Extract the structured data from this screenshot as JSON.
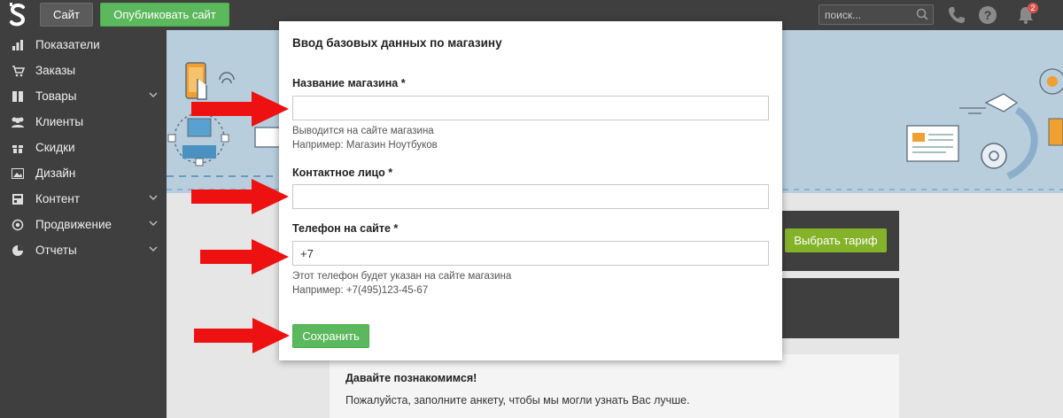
{
  "topbar": {
    "logo_text": "S",
    "site_label": "Сайт",
    "publish_label": "Опубликовать сайт",
    "search_placeholder": "поиск...",
    "notifications_count": "2"
  },
  "sidebar": {
    "items": [
      {
        "label": "Показатели",
        "icon": "bar-chart-icon"
      },
      {
        "label": "Заказы",
        "icon": "cart-icon"
      },
      {
        "label": "Товары",
        "icon": "book-icon",
        "expandable": true
      },
      {
        "label": "Клиенты",
        "icon": "users-icon"
      },
      {
        "label": "Скидки",
        "icon": "gift-icon"
      },
      {
        "label": "Дизайн",
        "icon": "image-icon"
      },
      {
        "label": "Контент",
        "icon": "layout-icon",
        "expandable": true
      },
      {
        "label": "Продвижение",
        "icon": "target-icon",
        "expandable": true
      },
      {
        "label": "Отчеты",
        "icon": "pie-chart-icon",
        "expandable": true
      }
    ]
  },
  "main": {
    "tariff_label": "Выбрать тариф",
    "card": {
      "title": "Давайте познакомимся!",
      "text": "Пожалуйста, заполните анкету, чтобы мы могли узнать Вас лучше."
    }
  },
  "modal": {
    "title": "Ввод базовых данных по магазину",
    "store_name": {
      "label": "Название магазина *",
      "value": "",
      "hint1": "Выводится на сайте магазина",
      "hint2": "Например: Магазин Ноутбуков"
    },
    "contact": {
      "label": "Контактное лицо *",
      "value": ""
    },
    "phone": {
      "label": "Телефон на сайте *",
      "value": "+7",
      "hint1": "Этот телефон будет указан на сайте магазина",
      "hint2": "Например: +7(495)123-45-67"
    },
    "save_label": "Сохранить"
  },
  "colors": {
    "topbar": "#3f3f3f",
    "green": "#5cb85c",
    "tariff_green": "#84b32a",
    "hero_blue": "#b9cedd",
    "arrow_red": "#ee1111"
  }
}
